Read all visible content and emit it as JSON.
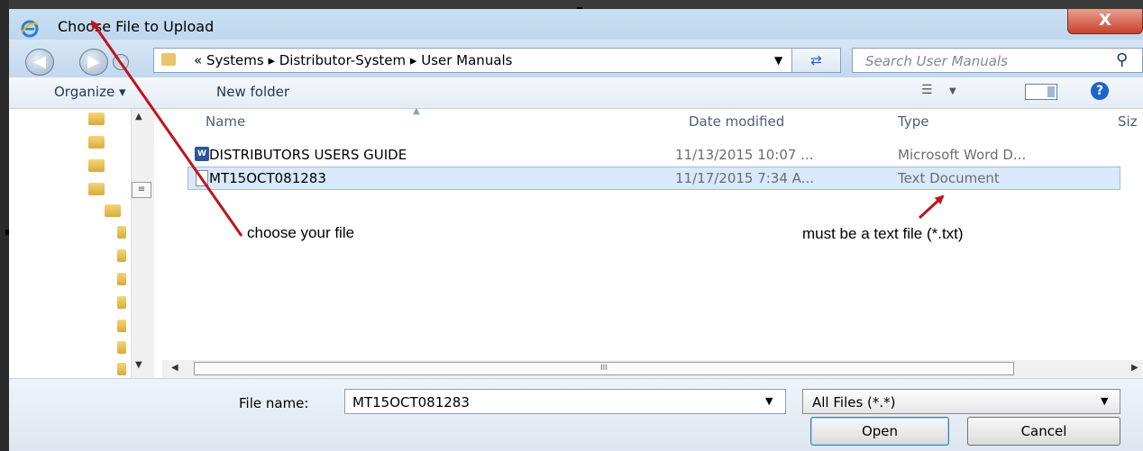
{
  "window": {
    "title": "Choose File to Upload",
    "close_label": "X"
  },
  "breadcrumb": {
    "text": "« Systems ▸ Distributor-System ▸ User Manuals"
  },
  "search": {
    "placeholder": "Search User Manuals"
  },
  "toolbar": {
    "organize": "Organize ▾",
    "new_folder": "New folder"
  },
  "columns": {
    "name": "Name",
    "date": "Date modified",
    "type": "Type",
    "size": "Siz"
  },
  "files": [
    {
      "name": "DISTRIBUTORS USERS GUIDE",
      "date": "11/13/2015 10:07 ...",
      "type": "Microsoft Word D...",
      "icon": "word-doc-icon"
    },
    {
      "name": "MT15OCT081283",
      "date": "11/17/2015 7:34 A...",
      "type": "Text Document",
      "icon": "text-file-icon",
      "selected": true
    }
  ],
  "scrollbar": {
    "thumb_glyph": "III"
  },
  "filename": {
    "label": "File name:",
    "value": "MT15OCT081283"
  },
  "filter": {
    "value": "All Files (*.*)"
  },
  "buttons": {
    "open": "Open",
    "cancel": "Cancel"
  },
  "annotations": {
    "choose": "choose your file",
    "text_file": "must be a text file (*.txt)"
  },
  "colors": {
    "arrow": "#c0141a",
    "selection": "#d9e8fb",
    "titlebar": "#c9dff2"
  }
}
